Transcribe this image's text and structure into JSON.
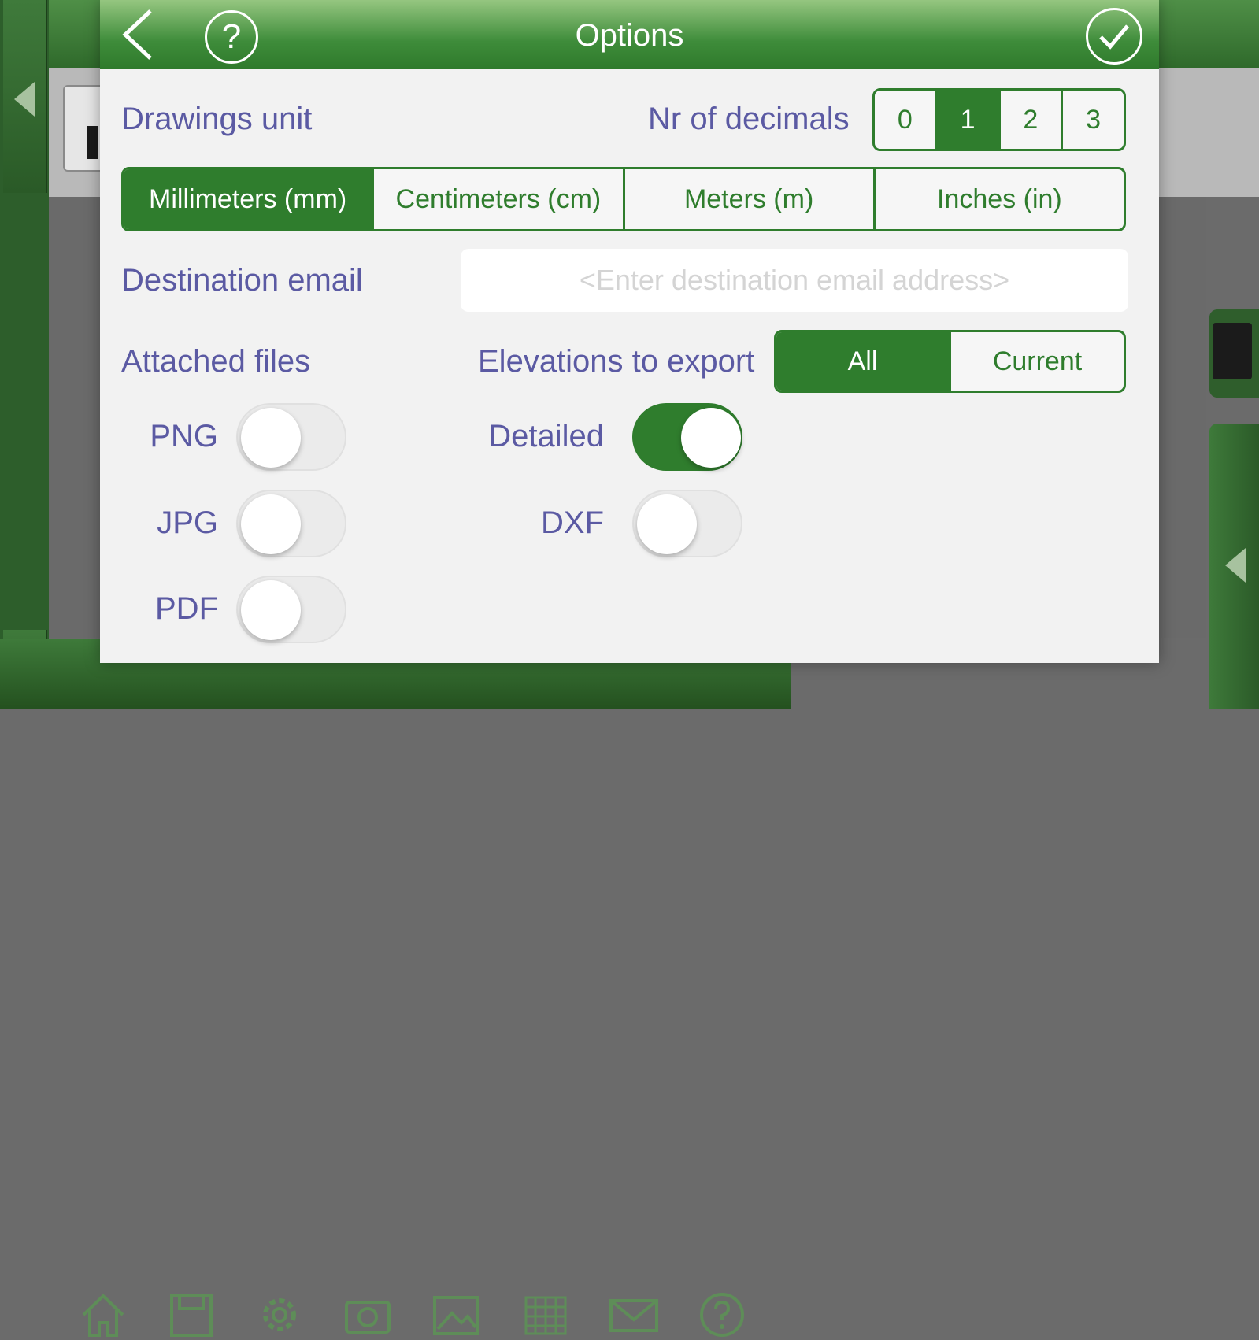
{
  "dialog": {
    "title": "Options",
    "drawings_unit": {
      "label": "Drawings unit",
      "options": [
        "Millimeters (mm)",
        "Centimeters (cm)",
        "Meters (m)",
        "Inches (in)"
      ],
      "selected": "Millimeters (mm)"
    },
    "decimals": {
      "label": "Nr of decimals",
      "options": [
        "0",
        "1",
        "2",
        "3"
      ],
      "selected": "1"
    },
    "email": {
      "label": "Destination email",
      "value": "",
      "placeholder": "<Enter destination email address>"
    },
    "attached_files": {
      "label": "Attached files",
      "png_label": "PNG",
      "png_on": false,
      "jpg_label": "JPG",
      "jpg_on": false,
      "pdf_label": "PDF",
      "pdf_on": false
    },
    "elevations": {
      "label": "Elevations to export",
      "options": [
        "All",
        "Current"
      ],
      "selected": "All"
    },
    "detailed_label": "Detailed",
    "detailed_on": true,
    "dxf_label": "DXF",
    "dxf_on": false
  },
  "colors": {
    "accent": "#2f7d2d",
    "label_text": "#5b5aa3",
    "header_top": "#95c680",
    "dialog_bg": "#f2f2f2"
  },
  "icons": {
    "header_left": [
      "back-chevron-icon",
      "help-icon"
    ],
    "header_right": "checkmark-icon",
    "bottom_toolbar": [
      "home-icon",
      "save-icon",
      "gear-icon",
      "camera-icon",
      "image-icon",
      "grid-icon",
      "mail-icon",
      "help-icon"
    ]
  }
}
